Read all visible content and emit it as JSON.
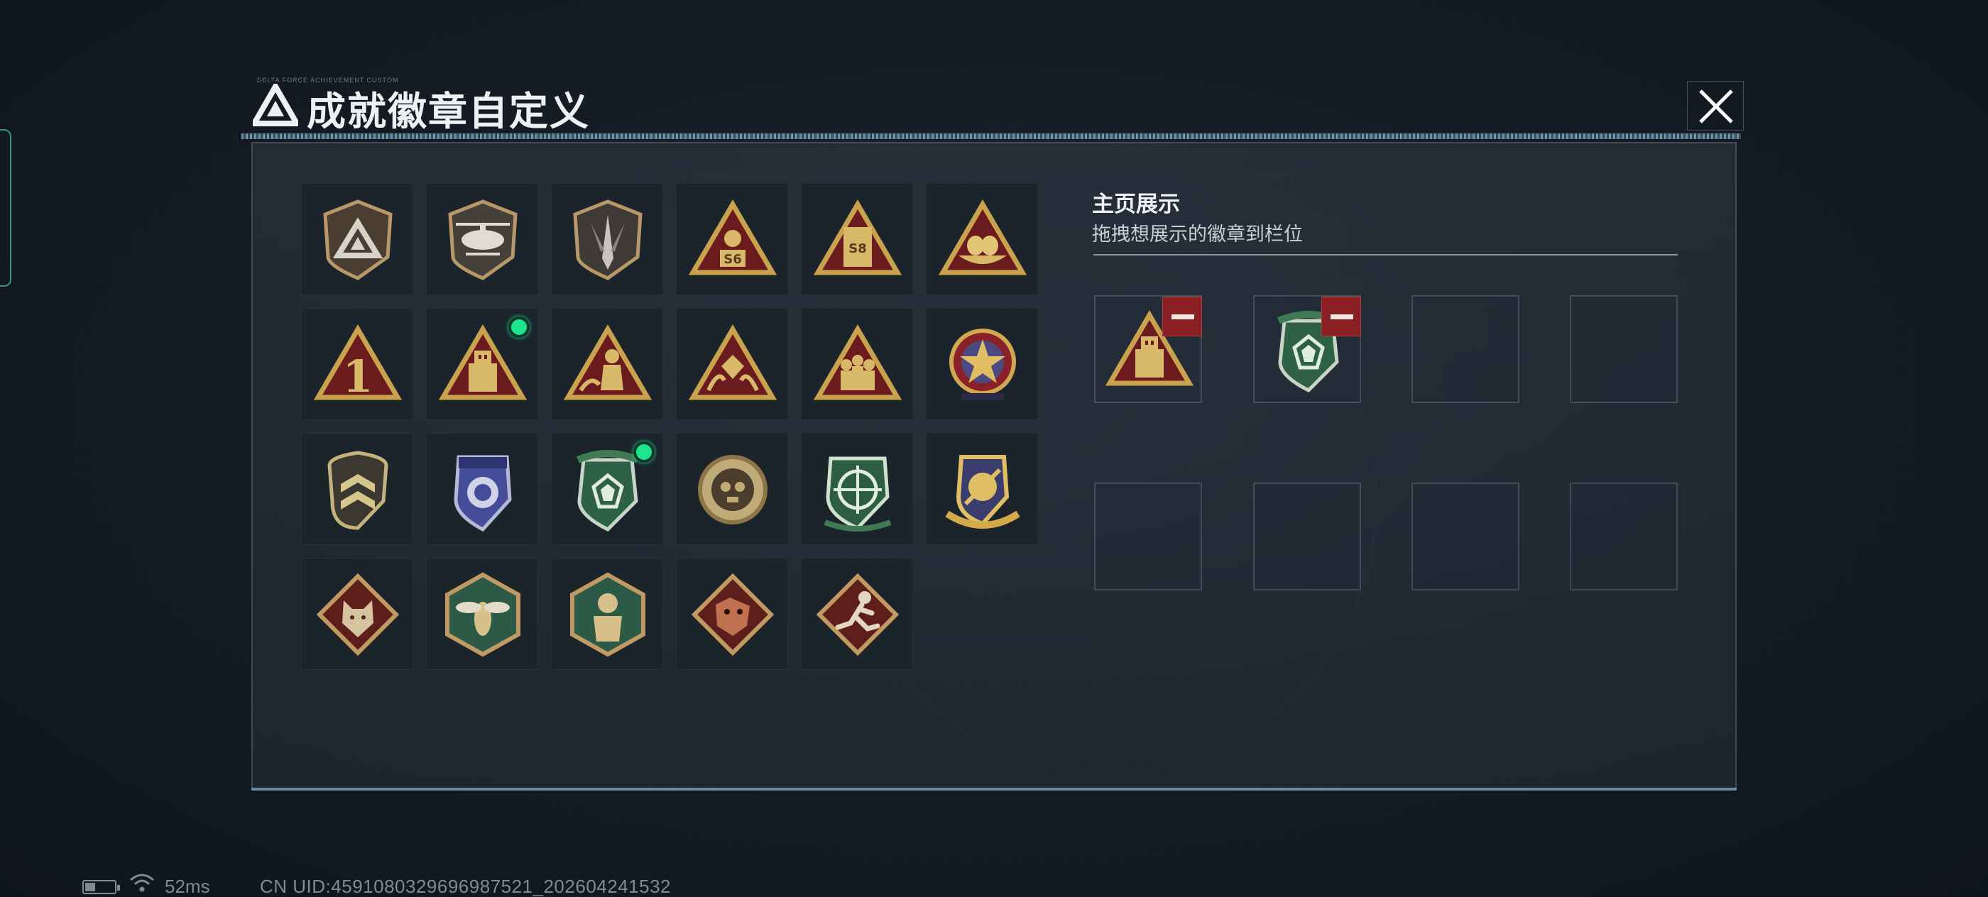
{
  "window": {
    "title": "成就徽章自定义",
    "title_deco": "DELTA FORCE ACHIEVEMENT CUSTOM"
  },
  "badges": [
    {
      "icon": "delta-shield-badge-icon",
      "row": 0,
      "col": 0
    },
    {
      "icon": "helicopter-shield-badge-icon",
      "row": 0,
      "col": 1
    },
    {
      "icon": "dagger-shield-badge-icon",
      "row": 0,
      "col": 2
    },
    {
      "icon": "s6-triangle-badge-icon",
      "row": 0,
      "col": 3,
      "label": "S6"
    },
    {
      "icon": "s8-triangle-badge-icon",
      "row": 0,
      "col": 4,
      "label": "S8"
    },
    {
      "icon": "eggs-triangle-badge-icon",
      "row": 0,
      "col": 5
    },
    {
      "icon": "number-one-triangle-badge-icon",
      "row": 1,
      "col": 0,
      "label": "1"
    },
    {
      "icon": "usb-triangle-badge-icon",
      "row": 1,
      "col": 1,
      "selected": true
    },
    {
      "icon": "soldier-wave-triangle-badge-icon",
      "row": 1,
      "col": 2
    },
    {
      "icon": "gem-hands-triangle-badge-icon",
      "row": 1,
      "col": 3
    },
    {
      "icon": "squad-triangle-badge-icon",
      "row": 1,
      "col": 4
    },
    {
      "icon": "star-medal-badge-icon",
      "row": 1,
      "col": 5
    },
    {
      "icon": "chevron-shield-badge-icon",
      "row": 2,
      "col": 0
    },
    {
      "icon": "blue-crest-badge-icon",
      "row": 2,
      "col": 1
    },
    {
      "icon": "green-gem-shield-badge-icon",
      "row": 2,
      "col": 2,
      "selected": true
    },
    {
      "icon": "skull-round-badge-icon",
      "row": 2,
      "col": 3
    },
    {
      "icon": "crosshair-shield-badge-icon",
      "row": 2,
      "col": 4
    },
    {
      "icon": "gold-wings-crest-badge-icon",
      "row": 2,
      "col": 5
    },
    {
      "icon": "wolf-diamond-badge-icon",
      "row": 3,
      "col": 0
    },
    {
      "icon": "hornet-hexagon-badge-icon",
      "row": 3,
      "col": 1
    },
    {
      "icon": "monkey-hexagon-badge-icon",
      "row": 3,
      "col": 2
    },
    {
      "icon": "dragon-diamond-badge-icon",
      "row": 3,
      "col": 3
    },
    {
      "icon": "runner-diamond-badge-icon",
      "row": 3,
      "col": 4
    }
  ],
  "display": {
    "title": "主页展示",
    "hint": "拖拽想展示的徽章到栏位",
    "slots": [
      {
        "badge": "usb-triangle-badge-icon",
        "removable": true
      },
      {
        "badge": "green-gem-shield-badge-icon",
        "removable": true
      },
      {
        "badge": null
      },
      {
        "badge": null
      },
      {
        "badge": null
      },
      {
        "badge": null
      },
      {
        "badge": null
      },
      {
        "badge": null
      }
    ]
  },
  "status": {
    "ping": "52ms",
    "uid": "CN UID:4591080329696987521_202604241532"
  },
  "colors": {
    "accent_green": "#1de48c",
    "remove_red": "#8a1f24",
    "gold": "#c9a24e",
    "maroon": "#6b1a1d"
  }
}
